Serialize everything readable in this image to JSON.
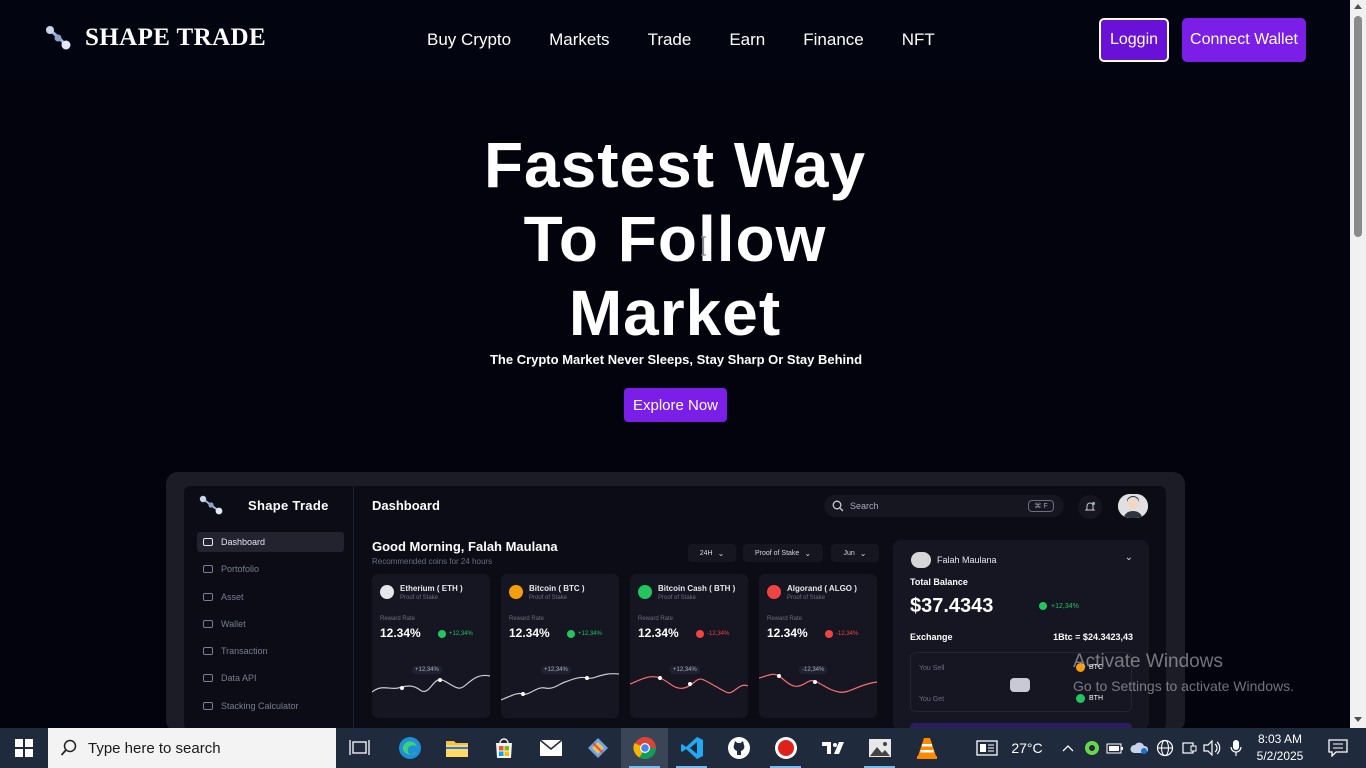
{
  "nav": {
    "brand": "SHAPE TRADE",
    "links": [
      "Buy Crypto",
      "Markets",
      "Trade",
      "Earn",
      "Finance",
      "NFT"
    ],
    "login_label": "Loggin",
    "wallet_label": "Connect Wallet"
  },
  "hero": {
    "title_lines": [
      "Fastest Way",
      "To Follow",
      "Market"
    ],
    "subtitle": "The Crypto Market Never Sleeps, Stay Sharp Or Stay Behind",
    "cta_label": "Explore Now"
  },
  "dashboard": {
    "brand": "Shape Trade",
    "header_title": "Dashboard",
    "search_placeholder": "Search",
    "search_shortcut": "⌘ F",
    "sidebar": [
      "Dashboard",
      "Portofolio",
      "Asset",
      "Wallet",
      "Transaction",
      "Data API",
      "Stacking Calculator"
    ],
    "greeting": "Good Morning, Falah Maulana",
    "greeting_sub": "Recommended coins for 24 hours",
    "filters": [
      "24H",
      "Proof of Stake",
      "Jun"
    ],
    "coins": [
      {
        "name": "Etherium ( ETH )",
        "type": "Proof of Stake",
        "rate_label": "Reward Rate",
        "rate": "12.34%",
        "change": "+12,34%",
        "change_color": "#22c55e",
        "tag": "+12,34%",
        "icon_color": "#e5e7eb",
        "trend": "up"
      },
      {
        "name": "Bitcoin ( BTC )",
        "type": "Proof of Stake",
        "rate_label": "Reward Rate",
        "rate": "12.34%",
        "change": "+12,34%",
        "change_color": "#22c55e",
        "tag": "+12,34%",
        "icon_color": "#f59e0b",
        "trend": "up"
      },
      {
        "name": "Bitcoin Cash ( BTH )",
        "type": "Proof of Stake",
        "rate_label": "Reward Rate",
        "rate": "12.34%",
        "change": "-12,34%",
        "change_color": "#ef4444",
        "tag": "+12,34%",
        "icon_color": "#22c55e",
        "trend": "down"
      },
      {
        "name": "Algorand ( ALGO )",
        "type": "Proof of Stake",
        "rate_label": "Reward Rate",
        "rate": "12.34%",
        "change": "-12,34%",
        "change_color": "#ef4444",
        "tag": "-12,34%",
        "icon_color": "#ef4444",
        "trend": "down"
      }
    ],
    "balance": {
      "user": "Falah Maulana",
      "label": "Total Balance",
      "value": "$37.4343",
      "change": "+12,34%",
      "exchange_label": "Exchange",
      "exchange_rate": "1Btc = $24.3423,43",
      "sell_label": "You Sell",
      "get_label": "You Get",
      "sell_token": "BTC",
      "get_token": "BTH"
    }
  },
  "watermark": {
    "line1": "Activate Windows",
    "line2": "Go to Settings to activate Windows."
  },
  "taskbar": {
    "search_placeholder": "Type here to search",
    "weather": "27°C",
    "time": "8:03 AM",
    "date": "5/2/2025"
  },
  "colors": {
    "accent": "#7a1ee8",
    "background": "#02030d",
    "taskbar": "#1f2a3d"
  }
}
